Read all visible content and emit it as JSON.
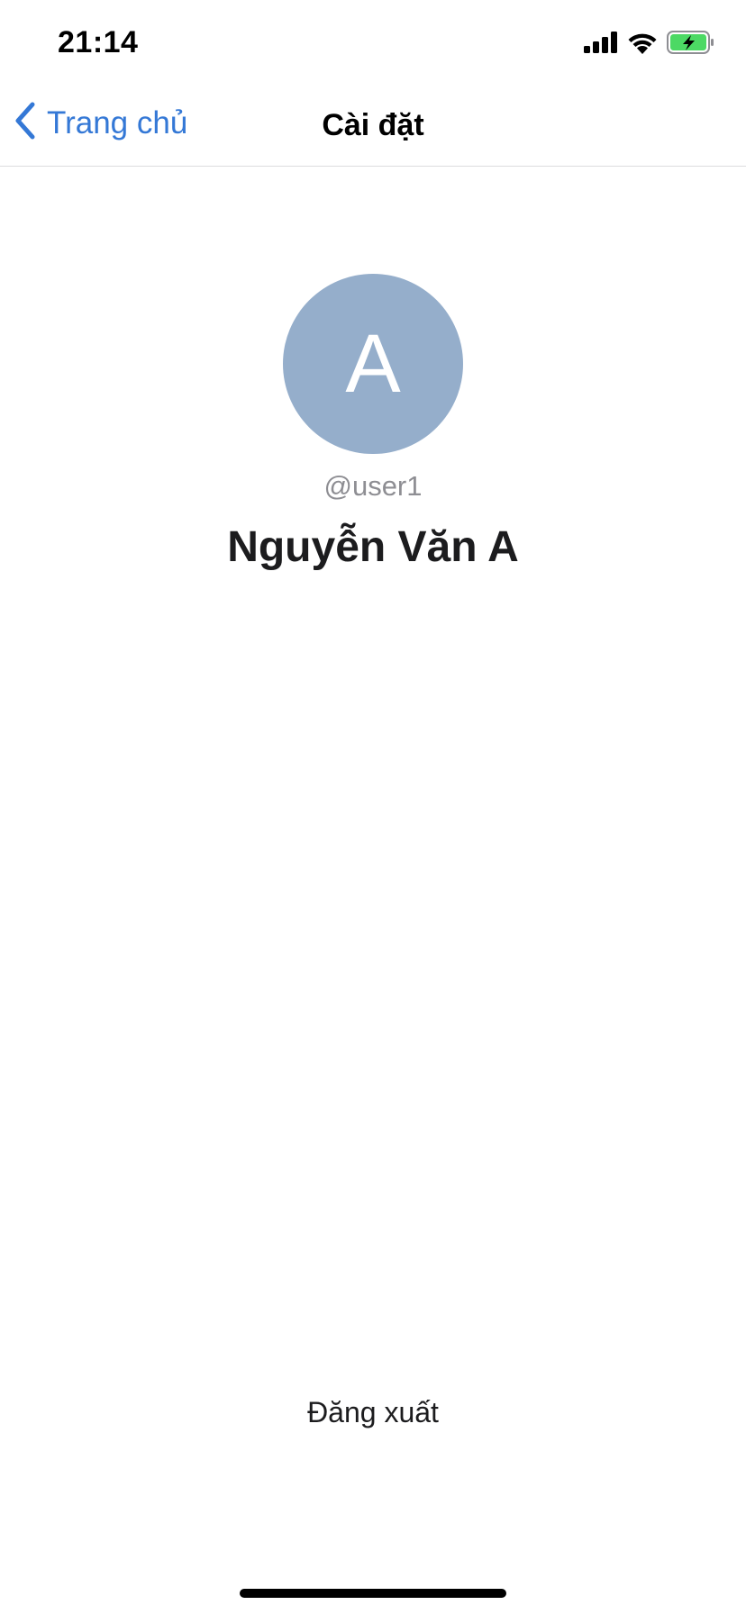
{
  "status_bar": {
    "time": "21:14",
    "icons": [
      "cellular-signal-icon",
      "wifi-icon",
      "battery-charging-icon"
    ],
    "battery_color": "#4cd964"
  },
  "nav": {
    "back_label": "Trang chủ",
    "title": "Cài đặt",
    "accent_color": "#3478d6"
  },
  "profile": {
    "avatar_initial": "A",
    "avatar_color": "#95aecb",
    "username": "@user1",
    "full_name": "Nguyễn Văn A"
  },
  "actions": {
    "logout_label": "Đăng xuất"
  }
}
